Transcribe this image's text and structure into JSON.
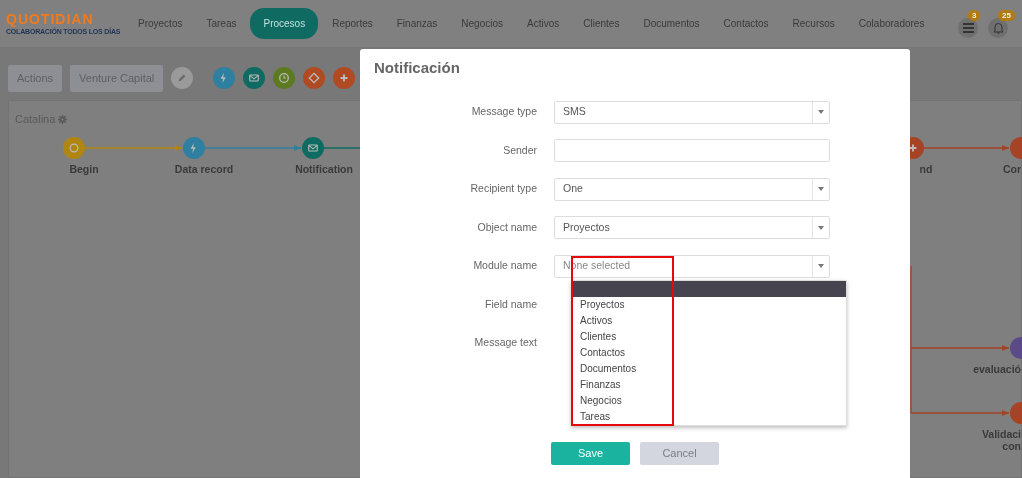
{
  "logo": {
    "name": "QUOTIDIAN",
    "tagline": "COLABORACIÓN TODOS LOS DÍAS"
  },
  "nav": [
    {
      "label": "Proyectos",
      "selected": false
    },
    {
      "label": "Tareas",
      "selected": false
    },
    {
      "label": "Procesos",
      "selected": true
    },
    {
      "label": "Reportes",
      "selected": false
    },
    {
      "label": "Finanzas",
      "selected": false
    },
    {
      "label": "Negocios",
      "selected": false
    },
    {
      "label": "Activos",
      "selected": false
    },
    {
      "label": "Clientes",
      "selected": false
    },
    {
      "label": "Documentos",
      "selected": false
    },
    {
      "label": "Contactos",
      "selected": false
    },
    {
      "label": "Recursos",
      "selected": false
    },
    {
      "label": "Colaboradores",
      "selected": false
    }
  ],
  "header_icons": [
    {
      "kind": "list",
      "badge": "3"
    },
    {
      "kind": "bell",
      "badge": "25"
    }
  ],
  "toolbar": {
    "buttons": [
      "Actions",
      "Venture Capital"
    ],
    "tools": [
      {
        "kind": "pencil",
        "color": "#9a9a9a"
      },
      {
        "kind": "bolt",
        "color": "#2e7fa0"
      },
      {
        "kind": "mail",
        "color": "#0f6b62"
      },
      {
        "kind": "clock",
        "color": "#5c7a20"
      },
      {
        "kind": "diamond",
        "color": "#b04a22"
      },
      {
        "kind": "plus",
        "color": "#b04a22"
      }
    ]
  },
  "process": {
    "name": "Catalina",
    "nodes": [
      {
        "label": "Begin",
        "kind": "circle",
        "color": "#b08510"
      },
      {
        "label": "Data record",
        "kind": "bolt",
        "color": "#2e7fa0"
      },
      {
        "label": "Notification",
        "kind": "mail",
        "color": "#0f6b62"
      },
      {
        "label": "nd",
        "kind": "plus",
        "color": "#a54324"
      },
      {
        "label": "Cor",
        "kind": "plain",
        "color": "#a54324"
      },
      {
        "label": "evaluació",
        "kind": "plain",
        "color": "#5b4a86"
      },
      {
        "label": "Validaci\ncon",
        "kind": "plain",
        "color": "#a54324"
      }
    ]
  },
  "modal": {
    "title": "Notificación",
    "fields": [
      {
        "label": "Message type",
        "kind": "select",
        "value": "SMS"
      },
      {
        "label": "Sender",
        "kind": "text"
      },
      {
        "label": "Recipient type",
        "kind": "select",
        "value": "One"
      },
      {
        "label": "Object name",
        "kind": "select",
        "value": "Proyectos"
      },
      {
        "label": "Module name",
        "kind": "select",
        "placeholder": "None selected",
        "expanded": true,
        "options": [
          "Proyectos",
          "Activos",
          "Clientes",
          "Contactos",
          "Documentos",
          "Finanzas",
          "Negocios",
          "Tareas"
        ],
        "highlighted": true
      },
      {
        "label": "Field name"
      },
      {
        "label": "Message text"
      }
    ],
    "buttons": [
      {
        "label": "Save",
        "kind": "primary"
      },
      {
        "label": "Cancel",
        "kind": "secondary"
      }
    ]
  }
}
